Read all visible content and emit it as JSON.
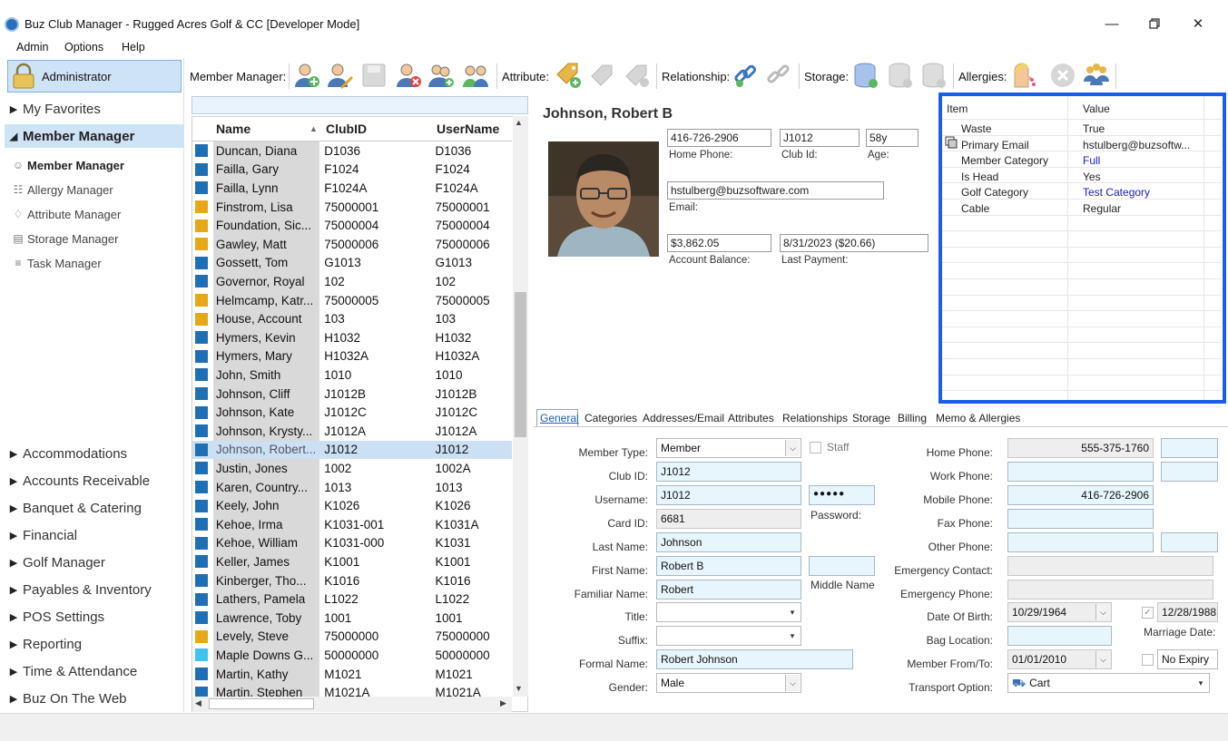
{
  "window": {
    "title": "Buz Club Manager - Rugged Acres Golf & CC [Developer Mode]"
  },
  "menu": [
    "Admin",
    "Options",
    "Help"
  ],
  "user": {
    "label": "Administrator"
  },
  "toolbar": {
    "member_manager_label": "Member Manager:",
    "attribute_label": "Attribute:",
    "relationship_label": "Relationship:",
    "storage_label": "Storage:",
    "allergies_label": "Allergies:"
  },
  "nav": {
    "favorites": "My Favorites",
    "member_manager": "Member Manager",
    "sub_items": [
      "Member Manager",
      "Allergy Manager",
      "Attribute Manager",
      "Storage Manager",
      "Task Manager"
    ],
    "groups": [
      "Accommodations",
      "Accounts Receivable",
      "Banquet & Catering",
      "Financial",
      "Golf Manager",
      "Payables & Inventory",
      "POS Settings",
      "Reporting",
      "Time & Attendance",
      "Buz On The Web"
    ]
  },
  "grid": {
    "columns": [
      "Name",
      "ClubID",
      "UserName"
    ],
    "rows": [
      {
        "name": "Duncan, Diana",
        "club_id": "D1036",
        "username": "D1036",
        "color": "#1f6fb5"
      },
      {
        "name": "Failla, Gary",
        "club_id": "F1024",
        "username": "F1024",
        "color": "#1f6fb5"
      },
      {
        "name": "Failla, Lynn",
        "club_id": "F1024A",
        "username": "F1024A",
        "color": "#1f6fb5"
      },
      {
        "name": "Finstrom, Lisa",
        "club_id": "75000001",
        "username": "75000001",
        "color": "#e6a817"
      },
      {
        "name": "Foundation,  Sic...",
        "club_id": "75000004",
        "username": "75000004",
        "color": "#e6a817"
      },
      {
        "name": "Gawley, Matt",
        "club_id": "75000006",
        "username": "75000006",
        "color": "#e6a817"
      },
      {
        "name": "Gossett, Tom",
        "club_id": "G1013",
        "username": "G1013",
        "color": "#1f6fb5"
      },
      {
        "name": "Governor, Royal",
        "club_id": "102",
        "username": "102",
        "color": "#1f6fb5"
      },
      {
        "name": "Helmcamp,  Katr...",
        "club_id": "75000005",
        "username": "75000005",
        "color": "#e6a817"
      },
      {
        "name": "House, Account",
        "club_id": "103",
        "username": "103",
        "color": "#e6a817"
      },
      {
        "name": "Hymers, Kevin",
        "club_id": "H1032",
        "username": "H1032",
        "color": "#1f6fb5"
      },
      {
        "name": "Hymers, Mary",
        "club_id": "H1032A",
        "username": "H1032A",
        "color": "#1f6fb5"
      },
      {
        "name": "John, Smith",
        "club_id": "1010",
        "username": "1010",
        "color": "#1f6fb5"
      },
      {
        "name": "Johnson, Cliff",
        "club_id": "J1012B",
        "username": "J1012B",
        "color": "#1f6fb5"
      },
      {
        "name": "Johnson, Kate",
        "club_id": "J1012C",
        "username": "J1012C",
        "color": "#1f6fb5"
      },
      {
        "name": "Johnson,  Krysty...",
        "club_id": "J1012A",
        "username": "J1012A",
        "color": "#1f6fb5"
      },
      {
        "name": "Johnson,  Robert...",
        "club_id": "J1012",
        "username": "J1012",
        "color": "#1f6fb5",
        "selected": true
      },
      {
        "name": "Justin, Jones",
        "club_id": "1002",
        "username": "1002A",
        "color": "#1f6fb5"
      },
      {
        "name": "Karen,  Country...",
        "club_id": "1013",
        "username": "1013",
        "color": "#1f6fb5"
      },
      {
        "name": "Keely, John",
        "club_id": "K1026",
        "username": "K1026",
        "color": "#1f6fb5"
      },
      {
        "name": "Kehoe, Irma",
        "club_id": "K1031-001",
        "username": "K1031A",
        "color": "#1f6fb5"
      },
      {
        "name": "Kehoe, William",
        "club_id": "K1031-000",
        "username": "K1031",
        "color": "#1f6fb5"
      },
      {
        "name": "Keller, James",
        "club_id": "K1001",
        "username": "K1001",
        "color": "#1f6fb5"
      },
      {
        "name": "Kinberger,  Tho...",
        "club_id": "K1016",
        "username": "K1016",
        "color": "#1f6fb5"
      },
      {
        "name": "Lathers, Pamela",
        "club_id": "L1022",
        "username": "L1022",
        "color": "#1f6fb5"
      },
      {
        "name": "Lawrence, Toby",
        "club_id": "1001",
        "username": "1001",
        "color": "#1f6fb5"
      },
      {
        "name": "Levely, Steve",
        "club_id": "75000000",
        "username": "75000000",
        "color": "#e6a817"
      },
      {
        "name": "Maple Downs G...",
        "club_id": "50000000",
        "username": "50000000",
        "color": "#3fc3ee"
      },
      {
        "name": "Martin, Kathy",
        "club_id": "M1021",
        "username": "M1021",
        "color": "#1f6fb5"
      },
      {
        "name": "Martin, Stephen",
        "club_id": "M1021A",
        "username": "M1021A",
        "color": "#1f6fb5"
      }
    ]
  },
  "member": {
    "name": "Johnson, Robert B",
    "home_phone": "416-726-2906",
    "home_phone_label": "Home Phone:",
    "club_id": "J1012",
    "club_id_label": "Club Id:",
    "age": "58y",
    "age_label": "Age:",
    "email": "hstulberg@buzsoftware.com",
    "email_label": "Email:",
    "balance": "$3,862.05",
    "balance_label": "Account Balance:",
    "last_payment": "8/31/2023 ($20.66)",
    "last_payment_label": "Last Payment:"
  },
  "properties": {
    "headers": [
      "Item",
      "Value"
    ],
    "rows": [
      {
        "item": "Waste",
        "value": "True",
        "color": "#222222"
      },
      {
        "item": "Primary Email",
        "value": "hstulberg@buzsoftw...",
        "color": "#222222"
      },
      {
        "item": "Member Category",
        "value": "Full",
        "color": "#1a1acc"
      },
      {
        "item": "Is Head",
        "value": "Yes",
        "color": "#222222"
      },
      {
        "item": "Golf Category",
        "value": "Test Category",
        "color": "#1a1acc"
      },
      {
        "item": "Cable",
        "value": "Regular",
        "color": "#222222"
      }
    ]
  },
  "tabs": [
    "General",
    "Categories",
    "Addresses/Email",
    "Attributes",
    "Relationships",
    "Storage",
    "Billing",
    "Memo & Allergies"
  ],
  "form": {
    "member_type_label": "Member Type:",
    "member_type": "Member",
    "staff_label": "Staff",
    "club_id_label": "Club ID:",
    "club_id": "J1012",
    "username_label": "Username:",
    "username": "J1012",
    "password": "●●●●●",
    "password_label": "Password:",
    "card_id_label": "Card ID:",
    "card_id": "6681",
    "last_name_label": "Last Name:",
    "last_name": "Johnson",
    "first_name_label": "First Name:",
    "first_name": "Robert B",
    "middle_name_label": "Middle Name",
    "familiar_name_label": "Familiar Name:",
    "familiar_name": "Robert",
    "title_label": "Title:",
    "suffix_label": "Suffix:",
    "formal_name_label": "Formal Name:",
    "formal_name": "Robert Johnson",
    "gender_label": "Gender:",
    "gender": "Male",
    "home_phone_label": "Home Phone:",
    "home_phone": "555-375-1760",
    "work_phone_label": "Work Phone:",
    "mobile_phone_label": "Mobile Phone:",
    "mobile_phone": "416-726-2906",
    "fax_phone_label": "Fax Phone:",
    "other_phone_label": "Other Phone:",
    "emergency_contact_label": "Emergency Contact:",
    "emergency_phone_label": "Emergency Phone:",
    "dob_label": "Date Of Birth:",
    "dob": "10/29/1964",
    "marriage_date": "12/28/1988",
    "marriage_date_label": "Marriage Date:",
    "bag_location_label": "Bag Location:",
    "member_from_label": "Member From/To:",
    "member_from": "01/01/2010",
    "no_expiry": "No Expiry",
    "transport_label": "Transport Option:",
    "transport": "Cart"
  }
}
